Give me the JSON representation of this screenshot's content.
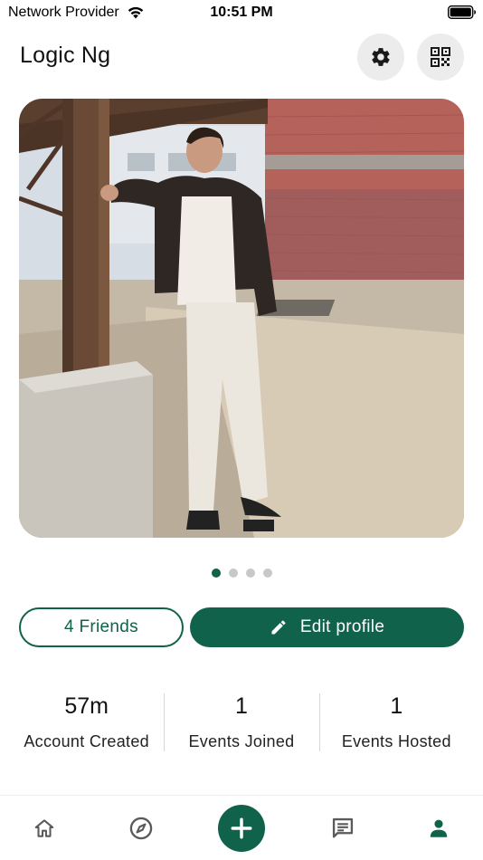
{
  "status_bar": {
    "carrier": "Network Provider",
    "time": "10:51 PM"
  },
  "header": {
    "title": "Logic Ng",
    "settings_icon": "gear-icon",
    "qr_icon": "qr-code-icon"
  },
  "photo": {
    "page_count": 4,
    "active_page": 1
  },
  "actions": {
    "friends_label": "4 Friends",
    "edit_label": "Edit profile",
    "edit_icon": "pencil-icon"
  },
  "stats": [
    {
      "value": "57m",
      "label": "Account Created"
    },
    {
      "value": "1",
      "label": "Events Joined"
    },
    {
      "value": "1",
      "label": "Events Hosted"
    }
  ],
  "tab_bar": {
    "items": [
      "home-icon",
      "compass-icon",
      "plus-icon",
      "chat-icon",
      "person-icon"
    ],
    "active": "person-icon"
  },
  "colors": {
    "accent": "#10624b",
    "inactive_icon": "#5a5a5a",
    "button_bg": "#ececec"
  }
}
